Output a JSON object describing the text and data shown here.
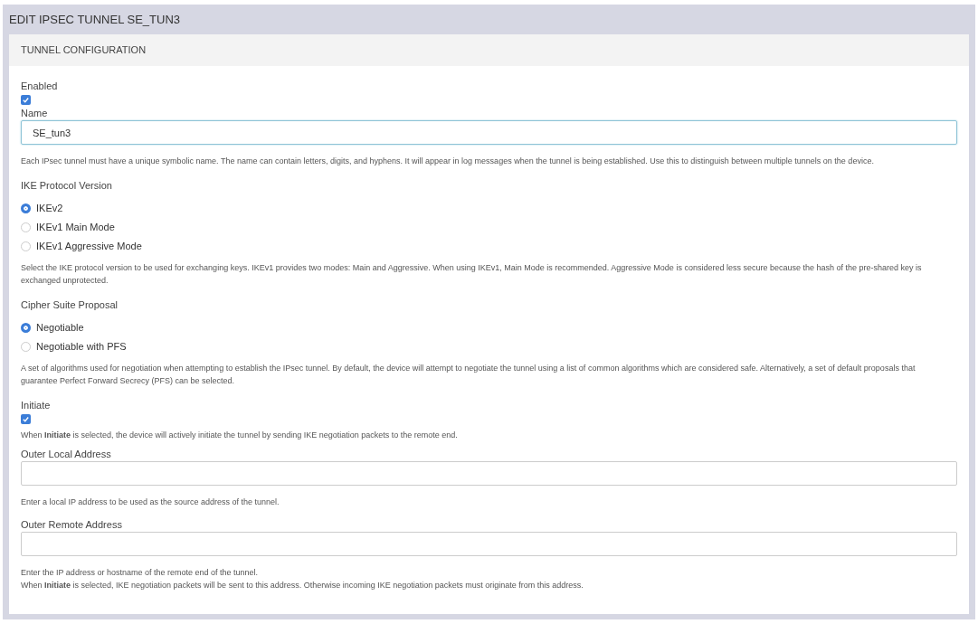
{
  "window": {
    "title": "EDIT IPSEC TUNNEL SE_TUN3"
  },
  "section": {
    "title": "TUNNEL CONFIGURATION"
  },
  "fields": [
    {
      "kind": "checkbox",
      "label": "Enabled",
      "checked": true
    },
    {
      "kind": "text",
      "label": "Name",
      "value": "SE_tun3",
      "focused": true,
      "help": [
        "Each IPsec tunnel must have a unique symbolic name. The name can contain letters, digits, and hyphens. It will appear in log messages when the tunnel is being established. Use this to distinguish between multiple tunnels on the device."
      ]
    },
    {
      "kind": "radio",
      "label": "IKE Protocol Version",
      "options": [
        {
          "label": "IKEv2",
          "selected": true
        },
        {
          "label": "IKEv1 Main Mode",
          "selected": false
        },
        {
          "label": "IKEv1 Aggressive Mode",
          "selected": false
        }
      ],
      "help": [
        "Select the IKE protocol version to be used for exchanging keys. IKEv1 provides two modes: Main and Aggressive. When using IKEv1, Main Mode is recommended. Aggressive Mode is considered less secure because the hash of the pre-shared key is exchanged unprotected."
      ]
    },
    {
      "kind": "radio",
      "label": "Cipher Suite Proposal",
      "options": [
        {
          "label": "Negotiable",
          "selected": true
        },
        {
          "label": "Negotiable with PFS",
          "selected": false
        }
      ],
      "help": [
        "A set of algorithms used for negotiation when attempting to establish the IPsec tunnel. By default, the device will attempt to negotiate the tunnel using a list of common algorithms which are considered safe. Alternatively, a set of default proposals that guarantee Perfect Forward Secrecy (PFS) can be selected."
      ]
    },
    {
      "kind": "checkbox",
      "label": "Initiate",
      "checked": true,
      "help": [
        "When **Initiate** is selected, the device will actively initiate the tunnel by sending IKE negotiation packets to the remote end."
      ]
    },
    {
      "kind": "text",
      "label": "Outer Local Address",
      "focused": false,
      "help": [
        "Enter a local IP address to be used as the source address of the tunnel."
      ]
    },
    {
      "kind": "text",
      "label": "Outer Remote Address",
      "focused": false,
      "help": [
        "Enter the IP address or hostname of the remote end of the tunnel.",
        "When **Initiate** is selected, IKE negotiation packets will be sent to this address. Otherwise incoming IKE negotiation packets must originate from this address."
      ]
    }
  ]
}
